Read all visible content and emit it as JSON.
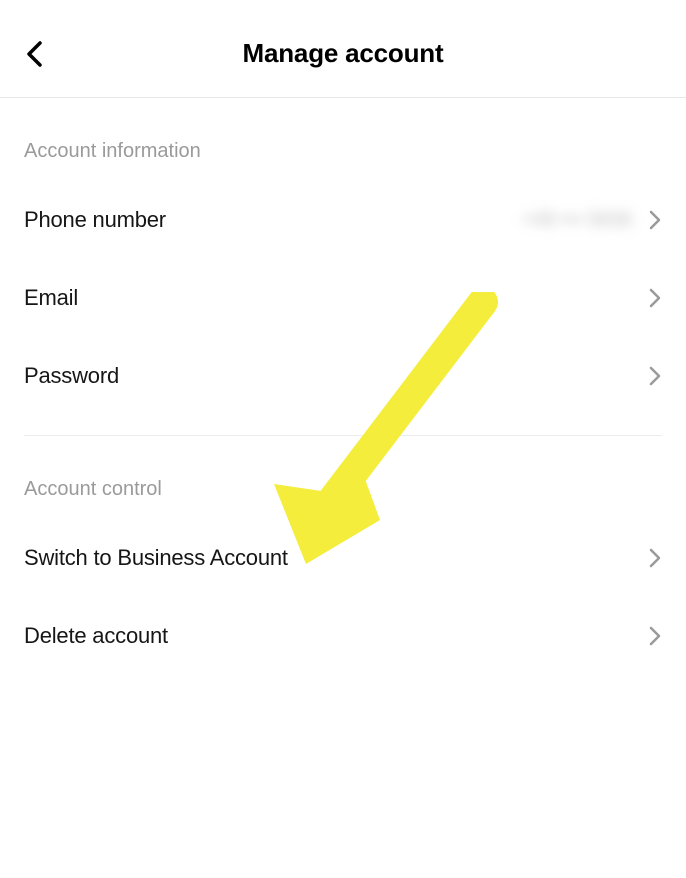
{
  "header": {
    "title": "Manage account"
  },
  "sections": {
    "account_information": {
      "title": "Account information",
      "phone_number": {
        "label": "Phone number",
        "value": "+49 ••• 5836"
      },
      "email": {
        "label": "Email"
      },
      "password": {
        "label": "Password"
      }
    },
    "account_control": {
      "title": "Account control",
      "switch_business": {
        "label": "Switch to Business Account"
      },
      "delete_account": {
        "label": "Delete account"
      }
    }
  }
}
